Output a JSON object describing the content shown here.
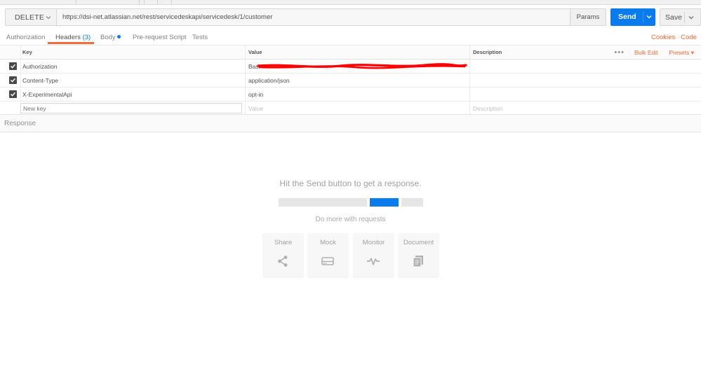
{
  "request": {
    "method": "DELETE",
    "url": "https://dsi-net.atlassian.net/rest/servicedeskapi/servicedesk/1/customer",
    "params_label": "Params",
    "send_label": "Send",
    "save_label": "Save"
  },
  "tabs": [
    {
      "label": "Authorization"
    },
    {
      "label": "Headers",
      "count": "(3)"
    },
    {
      "label": "Body"
    },
    {
      "label": "Pre-request Script"
    },
    {
      "label": "Tests"
    }
  ],
  "links": {
    "cookies": "Cookies",
    "code": "Code"
  },
  "headers_table": {
    "columns": [
      "Key",
      "Value",
      "Description"
    ],
    "bulk_edit": "Bulk Edit",
    "presets": "Presets",
    "rows": [
      {
        "key": "Authorization",
        "value": "Basi",
        "description": ""
      },
      {
        "key": "Content-Type",
        "value": "application/json",
        "description": ""
      },
      {
        "key": "X-ExperimentalApi",
        "value": "opt-in",
        "description": ""
      }
    ],
    "new_row": {
      "key_placeholder": "New key",
      "value_placeholder": "Value",
      "description_placeholder": "Description"
    }
  },
  "response": {
    "title": "Response",
    "empty_message": "Hit the Send button to get a response.",
    "more_label": "Do more with requests",
    "actions": [
      {
        "label": "Share",
        "icon": "share-icon"
      },
      {
        "label": "Mock",
        "icon": "mock-server-icon"
      },
      {
        "label": "Monitor",
        "icon": "monitor-pulse-icon"
      },
      {
        "label": "Document",
        "icon": "document-icon"
      }
    ]
  },
  "colors": {
    "accent": "#097bed",
    "orange": "#f26b3a",
    "redaction": "#ff0000"
  }
}
